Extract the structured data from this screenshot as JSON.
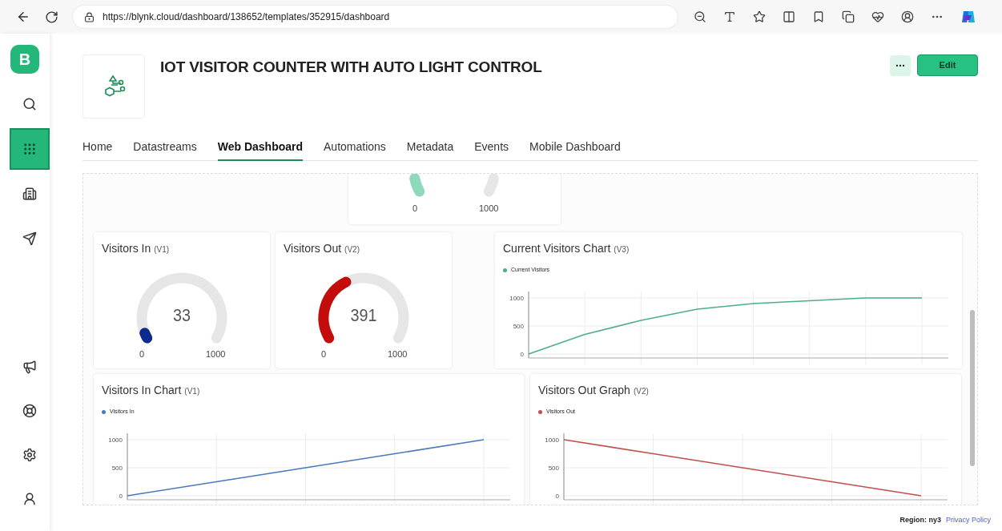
{
  "browser": {
    "url": "https://blynk.cloud/dashboard/138652/templates/352915/dashboard"
  },
  "sidebar": {
    "logo": "B",
    "top_items": [
      {
        "selected": false
      },
      {
        "selected": true
      },
      {
        "selected": false
      },
      {
        "selected": false
      }
    ],
    "bottom_items": [
      {
        "selected": false
      },
      {
        "selected": false
      },
      {
        "selected": false
      },
      {
        "selected": false
      }
    ]
  },
  "header": {
    "title": "IOT VISITOR COUNTER WITH AUTO LIGHT CONTROL",
    "edit_button": "Edit"
  },
  "tabs": [
    {
      "label": "Home",
      "selected": false
    },
    {
      "label": "Datastreams",
      "selected": false
    },
    {
      "label": "Web Dashboard",
      "selected": true
    },
    {
      "label": "Automations",
      "selected": false
    },
    {
      "label": "Metadata",
      "selected": false
    },
    {
      "label": "Events",
      "selected": false
    },
    {
      "label": "Mobile Dashboard",
      "selected": false
    }
  ],
  "partial_gauge": {
    "min": "0",
    "max": "1000",
    "color": "#8fd9bb"
  },
  "gauges": [
    {
      "title": "Visitors In",
      "pin": "(V1)",
      "value": "33",
      "min": "0",
      "max": "1000",
      "color": "#0d2a8f"
    },
    {
      "title": "Visitors Out",
      "pin": "(V2)",
      "value": "391",
      "min": "0",
      "max": "1000",
      "color": "#c40c0c"
    }
  ],
  "current_chart": {
    "title": "Current Visitors Chart",
    "pin": "(V3)",
    "chart_data": {
      "type": "line",
      "series": [
        {
          "name": "Current Visitors",
          "color": "#4caf85",
          "values": [
            0,
            350,
            600,
            800,
            900,
            950,
            1000,
            1000
          ]
        }
      ],
      "grid": true,
      "ylim": [
        0,
        1000
      ],
      "yticks": [
        0,
        500,
        1000
      ]
    }
  },
  "bottom_charts": [
    {
      "title": "Visitors In Chart",
      "pin": "(V1)",
      "chart_data": {
        "type": "line",
        "series": [
          {
            "name": "Visitors In",
            "color": "#4a78c0",
            "values": [
              0,
              250,
              500,
              750,
              1000
            ]
          }
        ],
        "grid": true,
        "ylim": [
          0,
          1000
        ],
        "yticks": [
          0,
          500,
          1000
        ]
      }
    },
    {
      "title": "Visitors Out Graph",
      "pin": "(V2)",
      "chart_data": {
        "type": "line",
        "series": [
          {
            "name": "Visitors Out",
            "color": "#c0504d",
            "values": [
              1000,
              750,
              500,
              250,
              0
            ]
          }
        ],
        "grid": true,
        "ylim": [
          0,
          1000
        ],
        "yticks": [
          0,
          500,
          1000
        ]
      }
    }
  ],
  "footer": {
    "region": "Region: ny3",
    "privacy_link": "Privacy Policy"
  }
}
